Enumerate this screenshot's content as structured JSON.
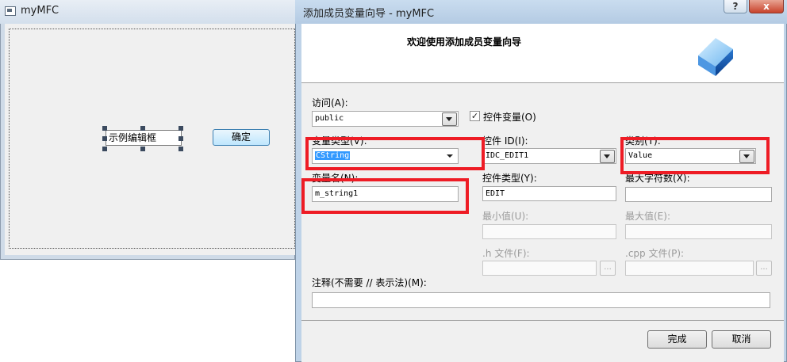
{
  "bg_window": {
    "title": "myMFC",
    "edit_text": "示例编辑框",
    "ok_button": "确定"
  },
  "dialog": {
    "title": "添加成员变量向导 - myMFC",
    "help_label": "?",
    "close_label": "x",
    "heading": "欢迎使用添加成员变量向导",
    "access": {
      "label": "访问(A):",
      "value": "public"
    },
    "control_variable": {
      "label": "控件变量(O)",
      "checked": true,
      "mark": "✓"
    },
    "variable_type": {
      "label": "变量类型(V):",
      "value": "CString"
    },
    "control_id": {
      "label": "控件 ID(I):",
      "value": "IDC_EDIT1"
    },
    "category": {
      "label": "类别(T):",
      "value": "Value"
    },
    "variable_name": {
      "label": "变量名(N):",
      "value": "m_string1"
    },
    "control_type": {
      "label": "控件类型(Y):",
      "value": "EDIT"
    },
    "max_chars": {
      "label": "最大字符数(X):",
      "value": ""
    },
    "min_value": {
      "label": "最小值(U):",
      "value": ""
    },
    "max_value": {
      "label": "最大值(E):",
      "value": ""
    },
    "h_file": {
      "label": ".h 文件(F):",
      "value": "",
      "browse": "..."
    },
    "cpp_file": {
      "label": ".cpp 文件(P):",
      "value": "",
      "browse": "..."
    },
    "comment": {
      "label": "注释(不需要 // 表示法)(M):",
      "value": ""
    },
    "finish_button": "完成",
    "cancel_button": "取消"
  },
  "colors": {
    "highlight_box": "#ee1c25",
    "selection": "#3399ff"
  }
}
